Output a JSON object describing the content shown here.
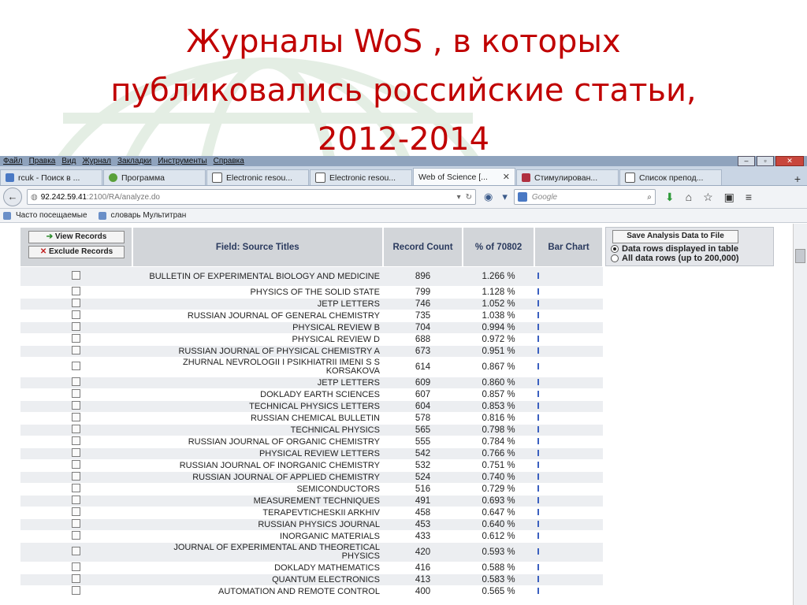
{
  "slide": {
    "title_lines": [
      "Журналы WoS , в которых",
      "публиковались российские статьи,",
      "2012-2014"
    ]
  },
  "browser": {
    "menu": [
      "Файл",
      "Правка",
      "Вид",
      "Журнал",
      "Закладки",
      "Инструменты",
      "Справка"
    ],
    "tabs": [
      {
        "label": "rcuk - Поиск в ...",
        "icon": "yandex-icon"
      },
      {
        "label": "Программа",
        "icon": "leaf-icon"
      },
      {
        "label": "Electronic resou...",
        "icon": "bookmark-k-icon"
      },
      {
        "label": "Electronic resou...",
        "icon": "bookmark-k-icon"
      },
      {
        "label": "Web of Science [...",
        "icon": "none",
        "active": true
      },
      {
        "label": "Стимулирован...",
        "icon": "mail-icon"
      },
      {
        "label": "Список препод...",
        "icon": "bookmark-k-icon"
      }
    ],
    "url": {
      "host": "92.242.59.41",
      "path": ":2100/RA/analyze.do"
    },
    "search_placeholder": "Google",
    "bookmarks": [
      "Часто посещаемые",
      "словарь Мультитран"
    ]
  },
  "toolbar": {
    "view_records": "View Records",
    "exclude_records": "Exclude Records"
  },
  "table": {
    "headers": {
      "field": "Field: Source Titles",
      "count": "Record Count",
      "percent": "% of 70802",
      "bar": "Bar Chart"
    },
    "rows": [
      {
        "title": "BULLETIN OF EXPERIMENTAL BIOLOGY AND MEDICINE",
        "count": "896",
        "pct": "1.266 %",
        "tall": true
      },
      {
        "title": "PHYSICS OF THE SOLID STATE",
        "count": "799",
        "pct": "1.128 %"
      },
      {
        "title": "JETP LETTERS",
        "count": "746",
        "pct": "1.052 %"
      },
      {
        "title": "RUSSIAN JOURNAL OF GENERAL CHEMISTRY",
        "count": "735",
        "pct": "1.038 %"
      },
      {
        "title": "PHYSICAL REVIEW B",
        "count": "704",
        "pct": "0.994 %"
      },
      {
        "title": "PHYSICAL REVIEW D",
        "count": "688",
        "pct": "0.972 %"
      },
      {
        "title": "RUSSIAN JOURNAL OF PHYSICAL CHEMISTRY A",
        "count": "673",
        "pct": "0.951 %"
      },
      {
        "title": "ZHURNAL NEVROLOGII I PSIKHIATRII IMENI S S KORSAKOVA",
        "count": "614",
        "pct": "0.867 %",
        "tall": true
      },
      {
        "title": "JETP LETTERS",
        "count": "609",
        "pct": "0.860 %"
      },
      {
        "title": "DOKLADY EARTH SCIENCES",
        "count": "607",
        "pct": "0.857 %"
      },
      {
        "title": "TECHNICAL PHYSICS LETTERS",
        "count": "604",
        "pct": "0.853 %"
      },
      {
        "title": "RUSSIAN CHEMICAL BULLETIN",
        "count": "578",
        "pct": "0.816 %"
      },
      {
        "title": "TECHNICAL PHYSICS",
        "count": "565",
        "pct": "0.798 %"
      },
      {
        "title": "RUSSIAN JOURNAL OF ORGANIC CHEMISTRY",
        "count": "555",
        "pct": "0.784 %"
      },
      {
        "title": "PHYSICAL REVIEW LETTERS",
        "count": "542",
        "pct": "0.766 %"
      },
      {
        "title": "RUSSIAN JOURNAL OF INORGANIC CHEMISTRY",
        "count": "532",
        "pct": "0.751 %"
      },
      {
        "title": "RUSSIAN JOURNAL OF APPLIED CHEMISTRY",
        "count": "524",
        "pct": "0.740 %"
      },
      {
        "title": "SEMICONDUCTORS",
        "count": "516",
        "pct": "0.729 %"
      },
      {
        "title": "MEASUREMENT TECHNIQUES",
        "count": "491",
        "pct": "0.693 %"
      },
      {
        "title": "TERAPEVTICHESKII ARKHIV",
        "count": "458",
        "pct": "0.647 %"
      },
      {
        "title": "RUSSIAN PHYSICS JOURNAL",
        "count": "453",
        "pct": "0.640 %"
      },
      {
        "title": "INORGANIC MATERIALS",
        "count": "433",
        "pct": "0.612 %"
      },
      {
        "title": "JOURNAL OF EXPERIMENTAL AND THEORETICAL PHYSICS",
        "count": "420",
        "pct": "0.593 %",
        "tall": true
      },
      {
        "title": "DOKLADY MATHEMATICS",
        "count": "416",
        "pct": "0.588 %"
      },
      {
        "title": "QUANTUM ELECTRONICS",
        "count": "413",
        "pct": "0.583 %"
      },
      {
        "title": "AUTOMATION AND REMOTE CONTROL",
        "count": "400",
        "pct": "0.565 %"
      }
    ]
  },
  "save_panel": {
    "button": "Save Analysis Data to File",
    "option1": "Data rows displayed in table",
    "option2": "All data rows (up to 200,000)"
  }
}
